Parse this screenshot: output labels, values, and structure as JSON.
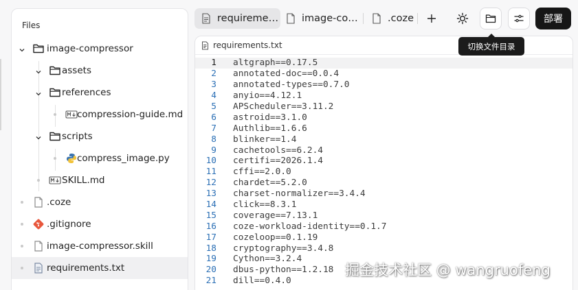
{
  "sidebar": {
    "title": "Files",
    "items": [
      {
        "label": "image-compressor",
        "icon": "folder-icon",
        "chevron": "down",
        "level": 0,
        "selected": false
      },
      {
        "label": "assets",
        "icon": "folder-icon",
        "chevron": "down",
        "level": 1,
        "selected": false
      },
      {
        "label": "references",
        "icon": "folder-icon",
        "chevron": "down",
        "level": 1,
        "selected": false
      },
      {
        "label": "compression-guide.md",
        "icon": "markdown-icon",
        "chevron": "",
        "level": 2,
        "selected": false
      },
      {
        "label": "scripts",
        "icon": "folder-icon",
        "chevron": "down",
        "level": 1,
        "selected": false
      },
      {
        "label": "compress_image.py",
        "icon": "python-icon",
        "chevron": "",
        "level": 2,
        "selected": false
      },
      {
        "label": "SKILL.md",
        "icon": "markdown-icon",
        "chevron": "",
        "level": 1,
        "selected": false
      },
      {
        "label": ".coze",
        "icon": "file-icon",
        "chevron": "",
        "level": 0,
        "selected": false
      },
      {
        "label": ".gitignore",
        "icon": "git-icon",
        "chevron": "",
        "level": 0,
        "selected": false
      },
      {
        "label": "image-compressor.skill",
        "icon": "file-icon",
        "chevron": "",
        "level": 0,
        "selected": false
      },
      {
        "label": "requirements.txt",
        "icon": "text-file-icon",
        "chevron": "",
        "level": 0,
        "selected": true
      }
    ]
  },
  "tabs": [
    {
      "label": "requireme…",
      "icon": "text-file-icon",
      "active": true
    },
    {
      "label": "image-co…",
      "icon": "file-icon",
      "active": false
    },
    {
      "label": ".coze",
      "icon": "file-icon",
      "active": false
    }
  ],
  "toolbar": {
    "add_icon": "plus-icon",
    "theme_icon": "sun-icon",
    "toggle_dir_icon": "folder-icon",
    "settings_icon": "sliders-icon",
    "deploy_label": "部署",
    "tooltip": "切换文件目录"
  },
  "editor": {
    "filename": "requirements.txt",
    "current_line": 1,
    "lines": [
      "altgraph==0.17.5",
      "annotated-doc==0.0.4",
      "annotated-types==0.7.0",
      "anyio==4.12.1",
      "APScheduler==3.11.2",
      "astroid==3.1.0",
      "Authlib==1.6.6",
      "blinker==1.4",
      "cachetools==6.2.4",
      "certifi==2026.1.4",
      "cffi==2.0.0",
      "chardet==5.2.0",
      "charset-normalizer==3.4.4",
      "click==8.3.1",
      "coverage==7.13.1",
      "coze-workload-identity==0.1.7",
      "cozeloop==0.1.19",
      "cryptography==3.4.8",
      "Cython==3.2.4",
      "dbus-python==1.2.18",
      "dill==0.4.0"
    ]
  },
  "watermark": "掘金技术社区 @ wangruofeng",
  "colors": {
    "line_number": "#2b6fb5",
    "deploy_bg": "#161616",
    "selected_row": "#f0f0f2",
    "git_icon": "#e8573c"
  }
}
